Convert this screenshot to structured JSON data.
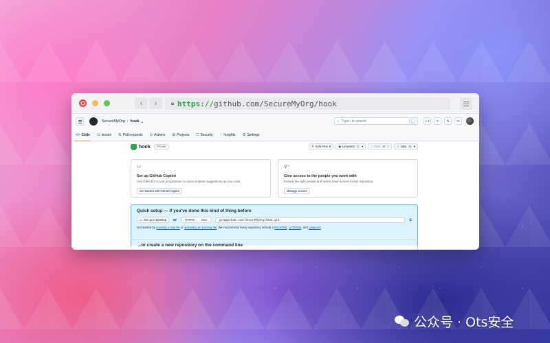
{
  "browser": {
    "url_scheme": "https://",
    "url_rest": "https://github.com/SecureMyOrg/hook"
  },
  "github": {
    "breadcrumb": {
      "org": "SecureMyOrg",
      "sep": "/",
      "repo": "hook"
    },
    "search_placeholder": "Type / to search",
    "tabs": [
      {
        "label": "Code",
        "icon": "<>"
      },
      {
        "label": "Issues",
        "icon": "⊙"
      },
      {
        "label": "Pull requests",
        "icon": "⇅"
      },
      {
        "label": "Actions",
        "icon": "⊙"
      },
      {
        "label": "Projects",
        "icon": "⊞"
      },
      {
        "label": "Security",
        "icon": "⛉"
      },
      {
        "label": "Insights",
        "icon": "⟋"
      },
      {
        "label": "Settings",
        "icon": "⚙"
      }
    ]
  },
  "repo": {
    "name": "hook",
    "visibility": "Private",
    "actions": {
      "edit_pins": "Edit Pins",
      "unwatch": "Unwatch",
      "unwatch_count": "1",
      "fork": "Fork",
      "fork_count": "0",
      "star": "Star",
      "star_count": "0"
    }
  },
  "cards": {
    "copilot": {
      "title": "Set up GitHub Copilot",
      "desc": "Use GitHub's AI pair programmer to autocomplete suggestions as you code.",
      "button": "Get started with GitHub Copilot"
    },
    "access": {
      "title": "Give access to the people you work with",
      "desc": "Ensure the right people and teams have access to this repository.",
      "button": "Manage access"
    }
  },
  "quick_setup": {
    "title": "Quick setup — if you've done this kind of thing before",
    "desktop_button": "Set up in Desktop",
    "or": "or",
    "https": "HTTPS",
    "ssh": "SSH",
    "clone_url": "git@github.com:SecureMyOrg/hook.git",
    "hint_pre": "Get started by ",
    "hint_link1": "creating a new file",
    "hint_mid1": " or ",
    "hint_link2": "uploading an existing file",
    "hint_mid2": ". We recommend every repository include a ",
    "hint_link3": "README",
    "hint_sep1": ", ",
    "hint_link4": "LICENSE",
    "hint_sep2": ", and ",
    "hint_link5": ".gitignore",
    "hint_end": "."
  },
  "command_line_title": "...or create a new repository on the command line",
  "watermark": "公众号 · Ots安全"
}
